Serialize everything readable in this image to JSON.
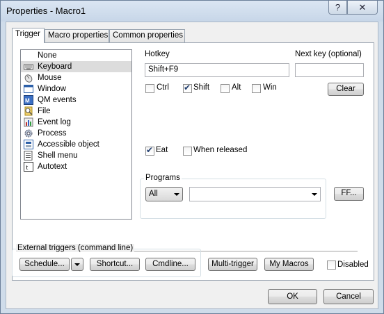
{
  "window": {
    "title": "Properties - Macro1",
    "help_glyph": "?",
    "close_glyph": "✕"
  },
  "tabs": [
    {
      "label": "Trigger",
      "active": true
    },
    {
      "label": "Macro properties",
      "active": false
    },
    {
      "label": "Common properties",
      "active": false
    }
  ],
  "trigger_types": [
    {
      "label": "None",
      "icon": "none",
      "selected": false
    },
    {
      "label": "Keyboard",
      "icon": "keyboard-icon",
      "selected": true
    },
    {
      "label": "Mouse",
      "icon": "mouse-icon",
      "selected": false
    },
    {
      "label": "Window",
      "icon": "window-icon",
      "selected": false
    },
    {
      "label": "QM events",
      "icon": "qm-events-icon",
      "selected": false
    },
    {
      "label": "File",
      "icon": "file-search-icon",
      "selected": false
    },
    {
      "label": "Event log",
      "icon": "event-log-icon",
      "selected": false
    },
    {
      "label": "Process",
      "icon": "process-gear-icon",
      "selected": false
    },
    {
      "label": "Accessible object",
      "icon": "accessible-object-icon",
      "selected": false
    },
    {
      "label": "Shell menu",
      "icon": "shell-menu-icon",
      "selected": false
    },
    {
      "label": "Autotext",
      "icon": "autotext-icon",
      "selected": false
    }
  ],
  "hotkey": {
    "label": "Hotkey",
    "value": "Shift+F9",
    "next_key_label": "Next key (optional)",
    "next_key_value": ""
  },
  "modifiers": {
    "ctrl": {
      "label": "Ctrl",
      "checked": false
    },
    "shift": {
      "label": "Shift",
      "checked": true
    },
    "alt": {
      "label": "Alt",
      "checked": false
    },
    "win": {
      "label": "Win",
      "checked": false
    }
  },
  "clear_label": "Clear",
  "eat": {
    "label": "Eat",
    "checked": true
  },
  "when_released": {
    "label": "When released",
    "checked": false
  },
  "programs": {
    "label": "Programs",
    "selected": "All",
    "program_value": "",
    "ff_label": "FF..."
  },
  "external": {
    "label": "External triggers (command line)",
    "schedule_label": "Schedule...",
    "shortcut_label": "Shortcut...",
    "cmdline_label": "Cmdline..."
  },
  "multi_trigger_label": "Multi-trigger",
  "my_macros_label": "My Macros",
  "disabled": {
    "label": "Disabled",
    "checked": false
  },
  "ok_label": "OK",
  "cancel_label": "Cancel",
  "check_glyph": "✔"
}
